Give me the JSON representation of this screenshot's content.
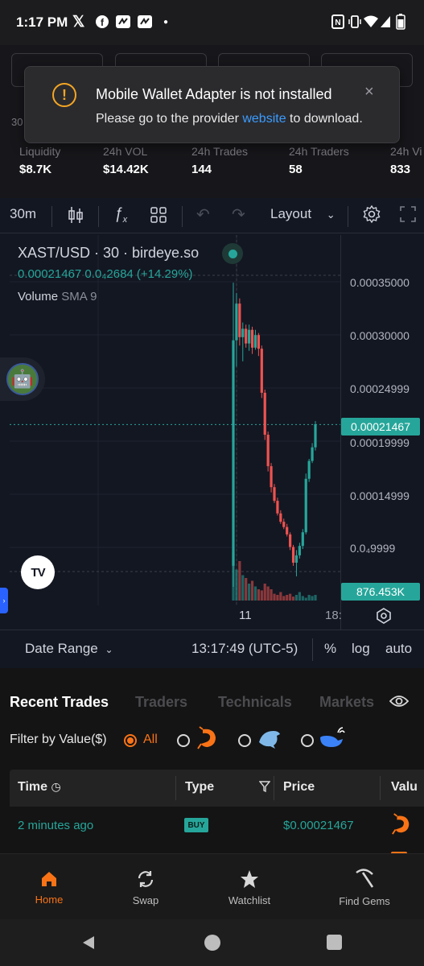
{
  "status_bar": {
    "time": "1:17 PM",
    "icons": [
      "x-icon",
      "facebook-icon",
      "app-icon",
      "app-icon",
      "dot-icon",
      "nfc-icon",
      "vibrate-icon",
      "wifi-icon",
      "signal-icon",
      "battery-icon"
    ]
  },
  "toast": {
    "title": "Mobile Wallet Adapter is not installed",
    "desc_before": "Please go to the provider ",
    "desc_link": "website",
    "desc_after": " to download.",
    "close": "×",
    "warn": "!"
  },
  "stats": {
    "partial_label": "30",
    "items": [
      {
        "label": "Liquidity",
        "value": "$8.7K"
      },
      {
        "label": "24h VOL",
        "value": "$14.42K"
      },
      {
        "label": "24h Trades",
        "value": "144"
      },
      {
        "label": "24h Traders",
        "value": "58"
      },
      {
        "label": "24h Vi",
        "value": "833"
      }
    ]
  },
  "toolbar": {
    "interval": "30m",
    "layout": "Layout"
  },
  "chart": {
    "symbol": "XAST/USD · 30 · birdeye.so",
    "price_line": "0.00021467  0.0₄2684 (+14.29%)",
    "volume_label": "Volume",
    "volume_sma": "SMA 9",
    "axis_labels": [
      "0.00035000",
      "0.00030000",
      "0.00024999",
      "0.00019999",
      "0.00014999",
      "0.0₄9999"
    ],
    "price_tag": "0.00021467",
    "volume_tag": "876.453K",
    "time_labels": [
      "11",
      "18:"
    ],
    "logo": "TV"
  },
  "chart_data": {
    "type": "candlestick",
    "title": "XAST/USD · 30 · birdeye.so",
    "ylim": [
      5e-05,
      0.00038
    ],
    "last_price": 0.00021467,
    "candles": [
      {
        "o": 8e-05,
        "h": 0.00035,
        "l": 6e-05,
        "c": 0.000295,
        "up": true
      },
      {
        "o": 0.000295,
        "h": 0.00034,
        "l": 0.00027,
        "c": 0.00033,
        "up": true
      },
      {
        "o": 0.00033,
        "h": 0.000335,
        "l": 0.00029,
        "c": 0.000298,
        "up": false
      },
      {
        "o": 0.000298,
        "h": 0.000312,
        "l": 0.000275,
        "c": 0.000306,
        "up": true
      },
      {
        "o": 0.000306,
        "h": 0.00031,
        "l": 0.000288,
        "c": 0.000292,
        "up": false
      },
      {
        "o": 0.000292,
        "h": 0.00031,
        "l": 0.000285,
        "c": 0.000305,
        "up": true
      },
      {
        "o": 0.000305,
        "h": 0.000308,
        "l": 0.000282,
        "c": 0.000288,
        "up": false
      },
      {
        "o": 0.000288,
        "h": 0.000305,
        "l": 0.000286,
        "c": 0.0003,
        "up": true
      },
      {
        "o": 0.0003,
        "h": 0.000302,
        "l": 0.00028,
        "c": 0.000287,
        "up": false
      },
      {
        "o": 0.000287,
        "h": 0.00029,
        "l": 0.00024,
        "c": 0.000245,
        "up": false
      },
      {
        "o": 0.000245,
        "h": 0.000248,
        "l": 0.0002,
        "c": 0.000205,
        "up": false
      },
      {
        "o": 0.000205,
        "h": 0.000208,
        "l": 0.00017,
        "c": 0.000175,
        "up": false
      },
      {
        "o": 0.000175,
        "h": 0.000178,
        "l": 0.00015,
        "c": 0.000155,
        "up": false
      },
      {
        "o": 0.000155,
        "h": 0.000158,
        "l": 0.00014,
        "c": 0.000142,
        "up": false
      },
      {
        "o": 0.000142,
        "h": 0.000145,
        "l": 0.000128,
        "c": 0.00013,
        "up": false
      },
      {
        "o": 0.00013,
        "h": 0.000133,
        "l": 0.00012,
        "c": 0.000122,
        "up": false
      },
      {
        "o": 0.000122,
        "h": 0.000125,
        "l": 0.000115,
        "c": 0.000117,
        "up": false
      },
      {
        "o": 0.000117,
        "h": 0.00012,
        "l": 0.000108,
        "c": 0.00011,
        "up": false
      },
      {
        "o": 0.00011,
        "h": 0.000112,
        "l": 9.5e-05,
        "c": 9.8e-05,
        "up": false
      },
      {
        "o": 9.8e-05,
        "h": 0.0001,
        "l": 8e-05,
        "c": 8.3e-05,
        "up": false
      },
      {
        "o": 8.3e-05,
        "h": 9.5e-05,
        "l": 7e-05,
        "c": 9e-05,
        "up": true
      },
      {
        "o": 9e-05,
        "h": 0.000102,
        "l": 8.7e-05,
        "c": 9.9e-05,
        "up": true
      },
      {
        "o": 9.9e-05,
        "h": 0.000115,
        "l": 9.6e-05,
        "c": 0.000112,
        "up": true
      },
      {
        "o": 0.000112,
        "h": 0.000168,
        "l": 0.00011,
        "c": 0.000163,
        "up": true
      },
      {
        "o": 0.000163,
        "h": 0.000182,
        "l": 0.00016,
        "c": 0.00018,
        "up": true
      },
      {
        "o": 0.00018,
        "h": 0.000197,
        "l": 0.000178,
        "c": 0.000193,
        "up": true
      },
      {
        "o": 0.000193,
        "h": 0.000218,
        "l": 0.00019,
        "c": 0.000215,
        "up": true
      }
    ],
    "volumes": [
      0.85,
      0.55,
      0.7,
      0.45,
      0.4,
      0.3,
      0.35,
      0.25,
      0.2,
      0.18,
      0.3,
      0.25,
      0.2,
      0.12,
      0.1,
      0.15,
      0.08,
      0.1,
      0.12,
      0.07,
      0.1,
      0.15,
      0.08,
      0.05,
      0.1,
      0.08,
      0.1
    ]
  },
  "date_row": {
    "date_range": "Date Range",
    "time": "13:17:49 (UTC-5)",
    "pct": "%",
    "log": "log",
    "auto": "auto"
  },
  "trades": {
    "tabs": [
      "Recent Trades",
      "Traders",
      "Technicals",
      "Markets"
    ],
    "filter_label": "Filter by Value($)",
    "filter_all": "All",
    "headers": [
      "Time",
      "Type",
      "Price",
      "Valu"
    ],
    "row": {
      "time": "2 minutes ago",
      "type": "BUY",
      "price": "$0.00021467"
    }
  },
  "bottom_nav": [
    {
      "label": "Home",
      "icon": "home-icon"
    },
    {
      "label": "Swap",
      "icon": "swap-icon"
    },
    {
      "label": "Watchlist",
      "icon": "star-icon"
    },
    {
      "label": "Find Gems",
      "icon": "pickaxe-icon"
    }
  ],
  "colors": {
    "up": "#26a69a",
    "down": "#ef5350",
    "accent": "#f97316",
    "link": "#3b9cff"
  }
}
